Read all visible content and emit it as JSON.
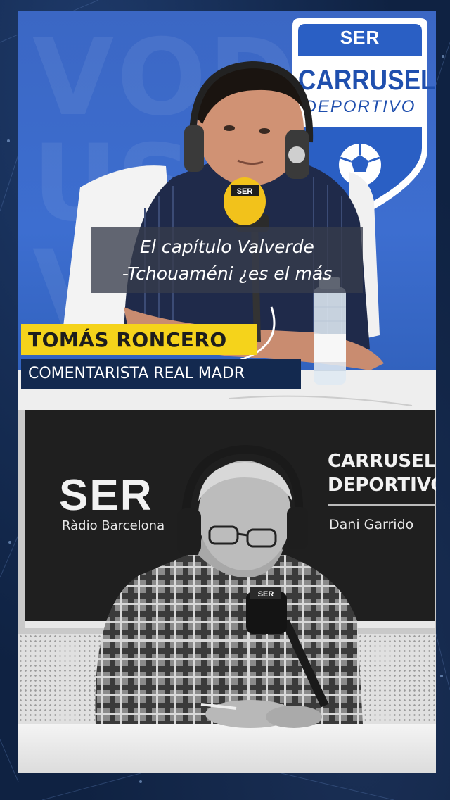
{
  "subtitle": {
    "line1": "El capítulo Valverde",
    "line2": "-Tchouaméni ¿es el más"
  },
  "lower_third": {
    "name": "TOMÁS RONCERO",
    "role": "COMENTARISTA REAL MADR"
  },
  "top_logo": {
    "network": "SER",
    "title": "CARRUSEL",
    "subtitle": "DEPORTIVO"
  },
  "microphone_top_flag": "SER",
  "bottom_backdrop": {
    "network": "SER",
    "station": "Ràdio Barcelona",
    "program_line1": "CARRUSEL",
    "program_line2": "DEPORTIVO",
    "host": "Dani Garrido"
  },
  "microphone_bottom_flag": "SER",
  "colors": {
    "name_plate": "#f5d31b",
    "role_plate": "#13294f",
    "studio_blue": "#3d6ed0",
    "frame_navy": "#0f2242"
  }
}
